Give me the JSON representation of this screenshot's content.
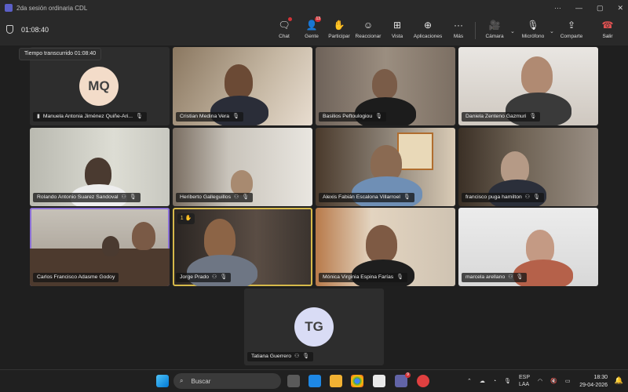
{
  "window": {
    "title": "2da sesión ordinaria CDL",
    "controls": [
      "···",
      "—",
      "▢",
      "✕"
    ]
  },
  "meeting": {
    "elapsed": "01:08:40",
    "tooltip": "Tiempo transcurrido 01:08:40"
  },
  "toolbar": {
    "chat": "Chat",
    "people": "Gente",
    "people_badge": "13",
    "raise": "Participar",
    "react": "Reaccionar",
    "view": "Vista",
    "apps": "Aplicaciones",
    "more": "Más",
    "camera": "Cámara",
    "mic": "Micrófono",
    "share": "Comparte",
    "leave": "Salir"
  },
  "participants": [
    {
      "name": "Manuela Antonia Jiménez Quiñe-Ari...",
      "initials": "MQ"
    },
    {
      "name": "Cristian Medina Vera"
    },
    {
      "name": "Basilios Peftoulogiou"
    },
    {
      "name": "Daniela Zenteno Gazmuri"
    },
    {
      "name": "Rolando Antonio Suarez Sandoval"
    },
    {
      "name": "Heriberto Galleguillos"
    },
    {
      "name": "Alexis Fabián Escalona Villarroel"
    },
    {
      "name": "francisco puga hamilton"
    },
    {
      "name": "Carlos Francisco Adasme Godoy"
    },
    {
      "name": "Jorge Prado",
      "hand": "1"
    },
    {
      "name": "Mónica Virginia Espina Farías"
    },
    {
      "name": "marcela arellano"
    },
    {
      "name": "Tatiana Guerrero",
      "initials": "TG"
    }
  ],
  "taskbar": {
    "search": "Buscar",
    "lang_top": "ESP",
    "lang_bottom": "LAA",
    "time": "18:30",
    "date": "29-04-2026",
    "teams_badge": "9"
  },
  "colors": {
    "accent": "#5b5fc7",
    "leave": "#e05252",
    "speaking": "#d6b94a",
    "pinned": "#8b6fd6"
  }
}
